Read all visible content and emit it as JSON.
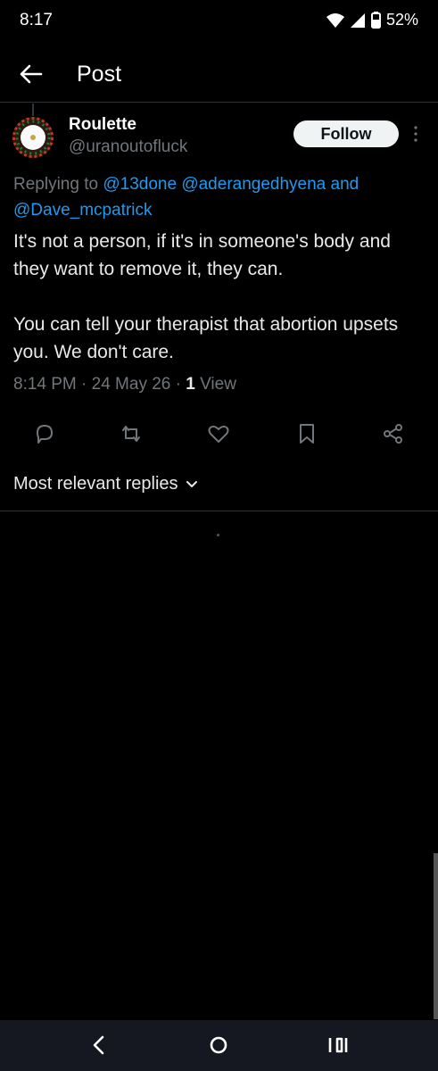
{
  "status_bar": {
    "time": "8:17",
    "battery": "52%"
  },
  "header": {
    "title": "Post"
  },
  "tweet": {
    "author_name": "Roulette",
    "author_handle": "@uranoutofluck",
    "follow_label": "Follow",
    "replying_prefix": "Replying to",
    "replying_mentions": [
      "@13done",
      "@aderangedhyena",
      "@Dave_mcpatrick"
    ],
    "replying_and": "and",
    "text": "It's not a person, if it's in someone's body and they want to remove it, they can.\n\nYou can tell your therapist that abortion upsets you. We don't care.",
    "timestamp": "8:14 PM · 24 May 26 · ",
    "views_count": "1",
    "views_label": " View"
  },
  "actions": [
    "reply-icon",
    "retweet-icon",
    "like-icon",
    "bookmark-icon",
    "share-icon"
  ],
  "replies": {
    "sort_label": "Most relevant replies"
  },
  "colors": {
    "accent": "#1d9bf0",
    "muted": "#71767b",
    "background": "#000000"
  }
}
